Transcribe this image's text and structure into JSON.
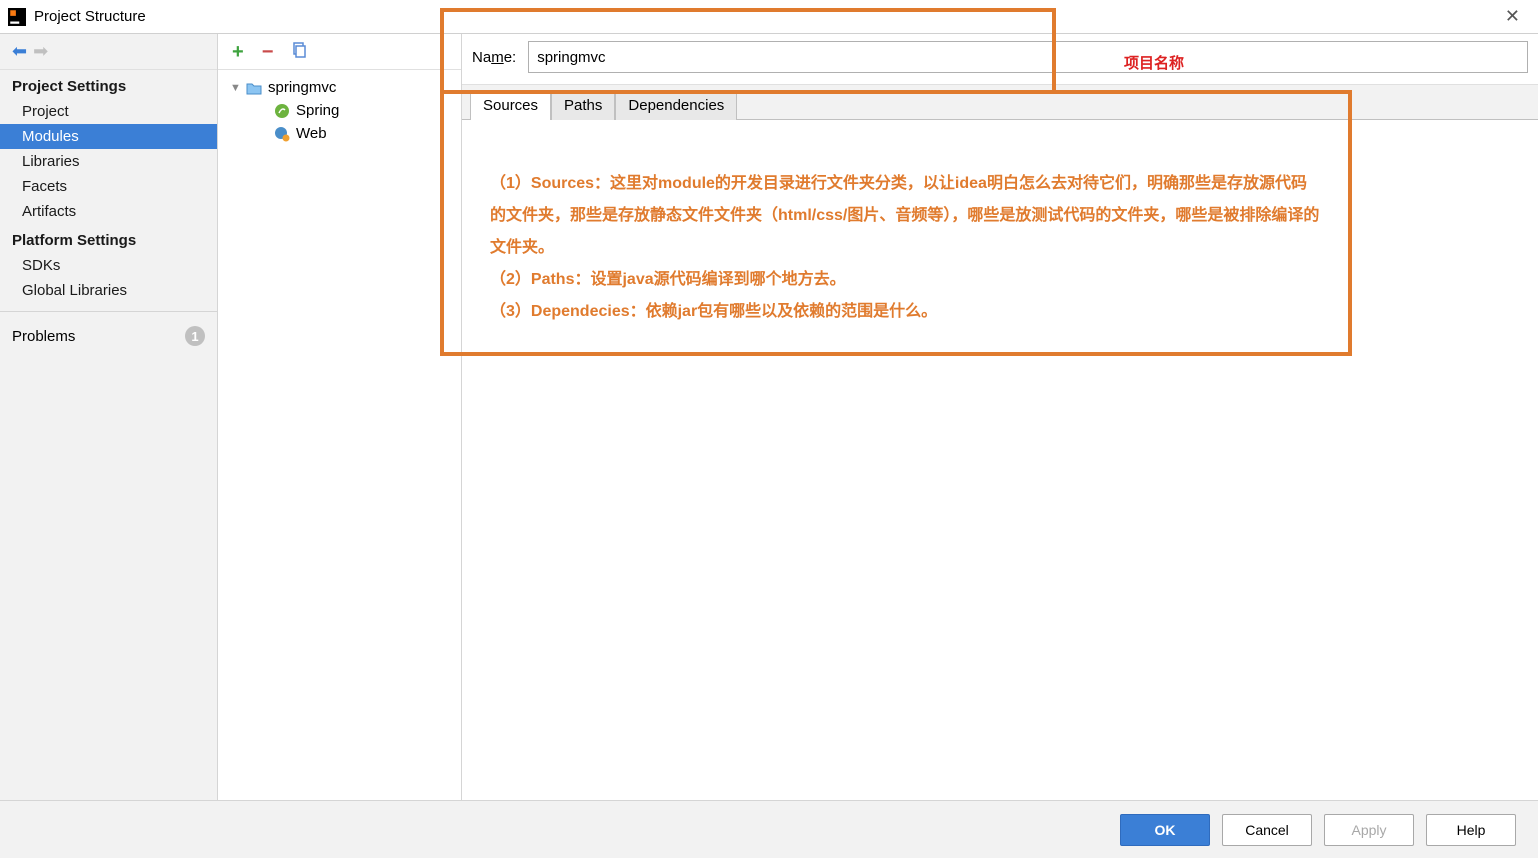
{
  "window": {
    "title": "Project Structure"
  },
  "sidebar": {
    "group1": "Project Settings",
    "items1": [
      "Project",
      "Modules",
      "Libraries",
      "Facets",
      "Artifacts"
    ],
    "selected": "Modules",
    "group2": "Platform Settings",
    "items2": [
      "SDKs",
      "Global Libraries"
    ],
    "problems_label": "Problems",
    "problems_count": "1"
  },
  "tree": {
    "root": "springmvc",
    "children": [
      "Spring",
      "Web"
    ]
  },
  "form": {
    "name_label_prefix": "Na",
    "name_label_underline": "m",
    "name_label_suffix": "e:",
    "name_value": "springmvc"
  },
  "tabs": {
    "items": [
      "Sources",
      "Paths",
      "Dependencies"
    ],
    "active": "Sources"
  },
  "annotations": {
    "name_hint": "项目名称",
    "line1": "（1）Sources：这里对module的开发目录进行文件夹分类，以让idea明白怎么去对待它们，明确那些是存放源代码的文件夹，那些是存放静态文件文件夹（html/css/图片、音频等），哪些是放测试代码的文件夹，哪些是被排除编译的文件夹。",
    "line2": "（2）Paths：设置java源代码编译到哪个地方去。",
    "line3": "（3）Dependecies：依赖jar包有哪些以及依赖的范围是什么。"
  },
  "footer": {
    "ok": "OK",
    "cancel": "Cancel",
    "apply": "Apply",
    "help": "Help"
  }
}
